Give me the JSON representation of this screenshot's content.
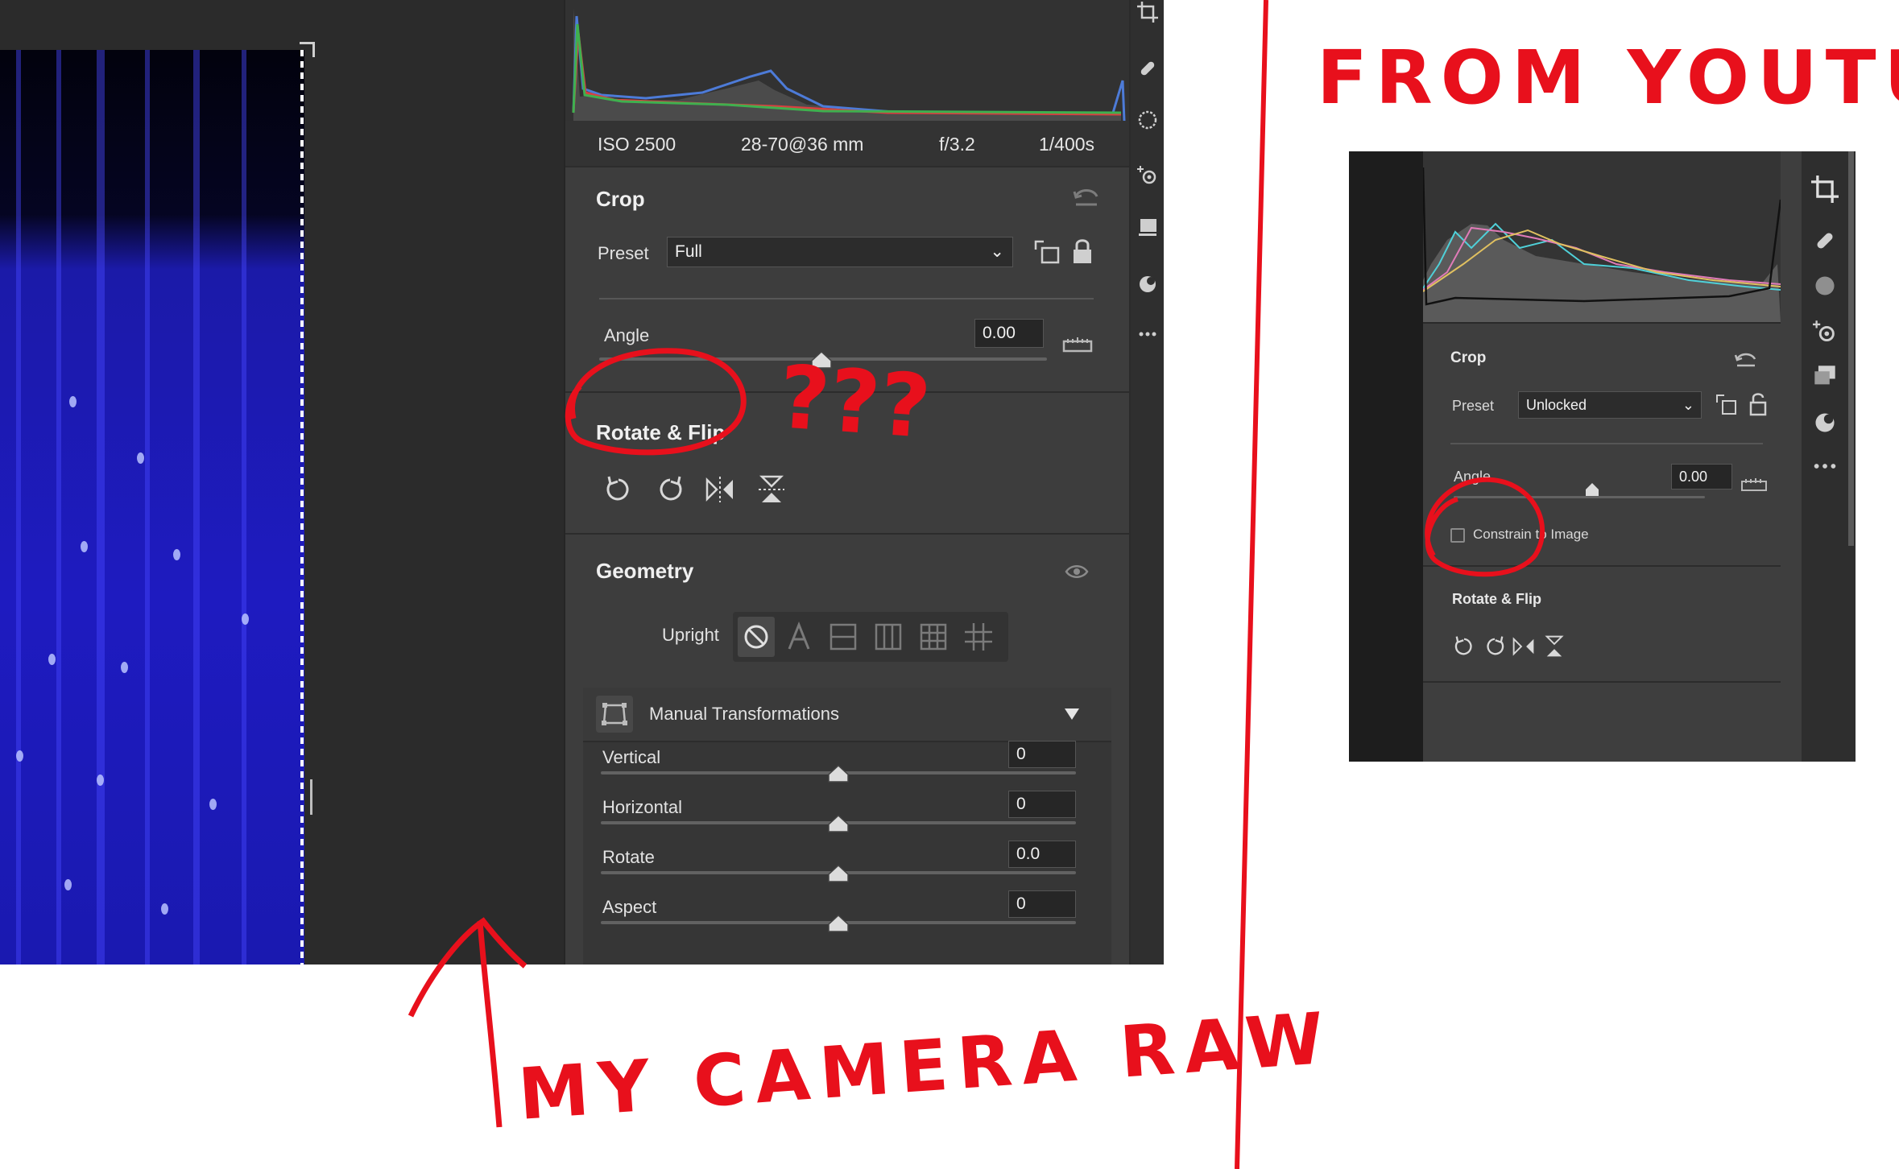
{
  "left": {
    "meta": {
      "iso": "ISO 2500",
      "lens": "28-70@36 mm",
      "aperture": "f/3.2",
      "shutter": "1/400s"
    },
    "crop": {
      "title": "Crop",
      "preset_label": "Preset",
      "preset_value": "Full",
      "angle_label": "Angle",
      "angle_value": "0.00",
      "rotate_flip_title": "Rotate & Flip"
    },
    "geometry": {
      "title": "Geometry",
      "upright_label": "Upright",
      "manual_title": "Manual Transformations",
      "sliders": [
        {
          "label": "Vertical",
          "value": "0"
        },
        {
          "label": "Horizontal",
          "value": "0"
        },
        {
          "label": "Rotate",
          "value": "0.0"
        },
        {
          "label": "Aspect",
          "value": "0"
        }
      ]
    }
  },
  "right": {
    "crop": {
      "title": "Crop",
      "preset_label": "Preset",
      "preset_value": "Unlocked",
      "angle_label": "Angle",
      "angle_value": "0.00",
      "constrain_label": "Constrain to Image",
      "rotate_flip_title": "Rotate & Flip"
    }
  },
  "annotations": {
    "from_youtube": "FROM YOUTUBE",
    "my_camera_raw": "MY CAMERA RAW",
    "question_marks": "???",
    "ink_color": "#e8101c"
  }
}
